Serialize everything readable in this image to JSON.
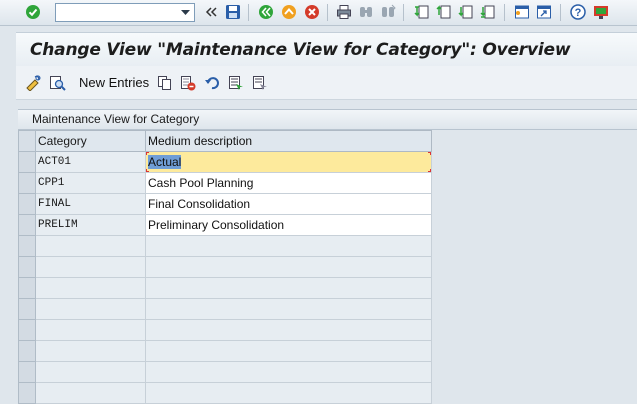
{
  "title": "Change View \"Maintenance View for Category\": Overview",
  "command_field": {
    "value": "",
    "placeholder": ""
  },
  "system_toolbar": {
    "icons": [
      "enter-icon",
      "history-icon",
      "save-icon",
      "back-icon",
      "exit-icon",
      "cancel-icon",
      "print-icon",
      "find-icon",
      "find-next-icon",
      "first-page-icon",
      "previous-page-icon",
      "next-page-icon",
      "last-page-icon",
      "new-session-icon",
      "shortcut-icon",
      "help-icon",
      "customize-layout-icon"
    ],
    "colors": {
      "accent_green": "#2fa53a",
      "cancel_red": "#d43b2a",
      "exit_orange": "#f0a020",
      "save_blue": "#2a5ea8"
    }
  },
  "app_toolbar": {
    "new_entries_label": "New Entries",
    "icons": [
      "display-change-icon",
      "other-view-icon",
      "copy-as-icon",
      "delete-icon",
      "undo-icon",
      "select-all-icon",
      "select-block-icon"
    ]
  },
  "table": {
    "title": "Maintenance View for Category",
    "columns": [
      "Category",
      "Medium description"
    ],
    "rows": [
      {
        "category": "ACT01",
        "description": "Actual",
        "focused": true
      },
      {
        "category": "CPP1",
        "description": "Cash Pool Planning"
      },
      {
        "category": "FINAL",
        "description": "Final Consolidation"
      },
      {
        "category": "PRELIM",
        "description": "Preliminary Consolidation"
      }
    ],
    "empty_rows": 8
  }
}
